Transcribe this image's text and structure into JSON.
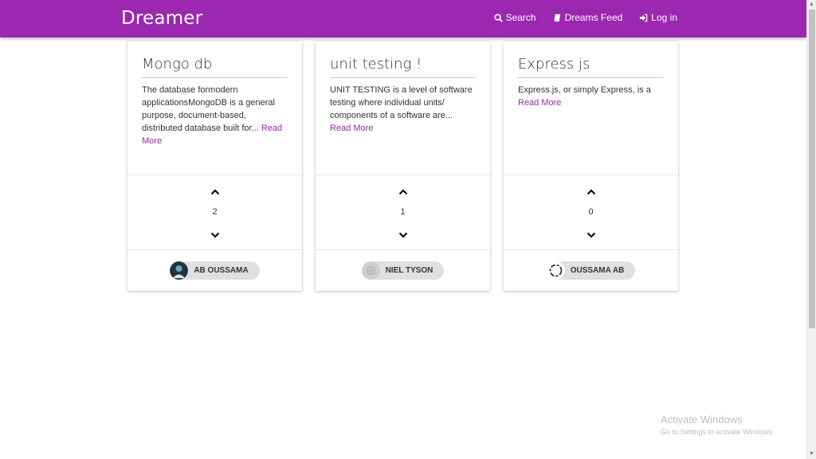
{
  "navbar": {
    "brand": "Dreamer",
    "links": [
      {
        "label": "Search",
        "icon": "search-icon"
      },
      {
        "label": "Dreams Feed",
        "icon": "book-icon"
      },
      {
        "label": "Log in",
        "icon": "sign-in-icon"
      }
    ]
  },
  "cards": [
    {
      "title": "Mongo db",
      "text": "The database formodern applicationsMongoDB is a general purpose, document-based, distributed database built for...",
      "read_more": "Read More",
      "votes": "2",
      "author": "AB OUSSAMA"
    },
    {
      "title": "unit testing !",
      "text": "UNIT TESTING is a level of software testing where individual units/ components of a software are...",
      "read_more": "Read More",
      "votes": "1",
      "author": "NIEL TYSON"
    },
    {
      "title": "Express js",
      "text": "Express.js, or simply Express, is a",
      "read_more": "Read More",
      "votes": "0",
      "author": "OUSSAMA AB"
    }
  ],
  "watermark": {
    "title": "Activate Windows",
    "subtitle": "Go to Settings to activate Windows."
  },
  "colors": {
    "primary": "#9c27b0",
    "chip": "#e0e0e0"
  }
}
